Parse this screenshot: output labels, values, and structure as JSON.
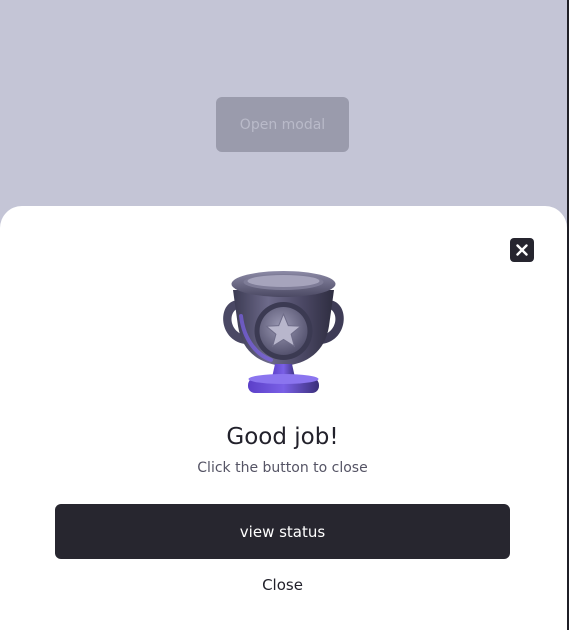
{
  "background": {
    "open_modal_label": "Open modal"
  },
  "modal": {
    "close_icon": "close-icon",
    "illustration": "trophy-icon",
    "title": "Good job!",
    "subtitle": "Click the button to close",
    "primary_button_label": "view status",
    "close_label": "Close"
  },
  "colors": {
    "backdrop": "#c4c5d6",
    "primary_button": "#27262f",
    "trophy_accent": "#6b4fd6"
  }
}
